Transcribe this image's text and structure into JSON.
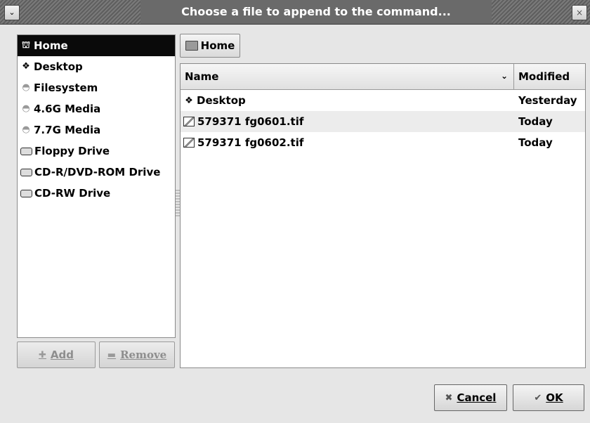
{
  "window": {
    "title": "Choose a file to append to the command...",
    "menu_glyph": "⌄",
    "close_glyph": "×"
  },
  "sidebar": {
    "items": [
      {
        "label": "Home",
        "icon": "home-icon",
        "glyph": "⛫",
        "selected": true
      },
      {
        "label": "Desktop",
        "icon": "desktop-icon",
        "glyph": "❖"
      },
      {
        "label": "Filesystem",
        "icon": "filesystem-icon",
        "glyph": "◓"
      },
      {
        "label": "4.6G Media",
        "icon": "media-icon",
        "glyph": "◓"
      },
      {
        "label": "7.7G Media",
        "icon": "media-icon",
        "glyph": "◓"
      },
      {
        "label": "Floppy Drive",
        "icon": "drive-icon"
      },
      {
        "label": "CD-R/DVD-ROM Drive",
        "icon": "drive-icon"
      },
      {
        "label": "CD-RW Drive",
        "icon": "drive-icon"
      }
    ],
    "add_label": "Add",
    "remove_label": "Remove"
  },
  "pathbar": {
    "current": "Home"
  },
  "filelist": {
    "columns": {
      "name": "Name",
      "modified": "Modified",
      "sort_glyph": "⌄"
    },
    "rows": [
      {
        "name": "Desktop",
        "modified": "Yesterday",
        "type": "folder"
      },
      {
        "name": "579371 fg0601.tif",
        "modified": "Today",
        "type": "image"
      },
      {
        "name": "579371 fg0602.tif",
        "modified": "Today",
        "type": "image"
      }
    ]
  },
  "buttons": {
    "cancel_label": "Cancel",
    "ok_label": "OK"
  }
}
